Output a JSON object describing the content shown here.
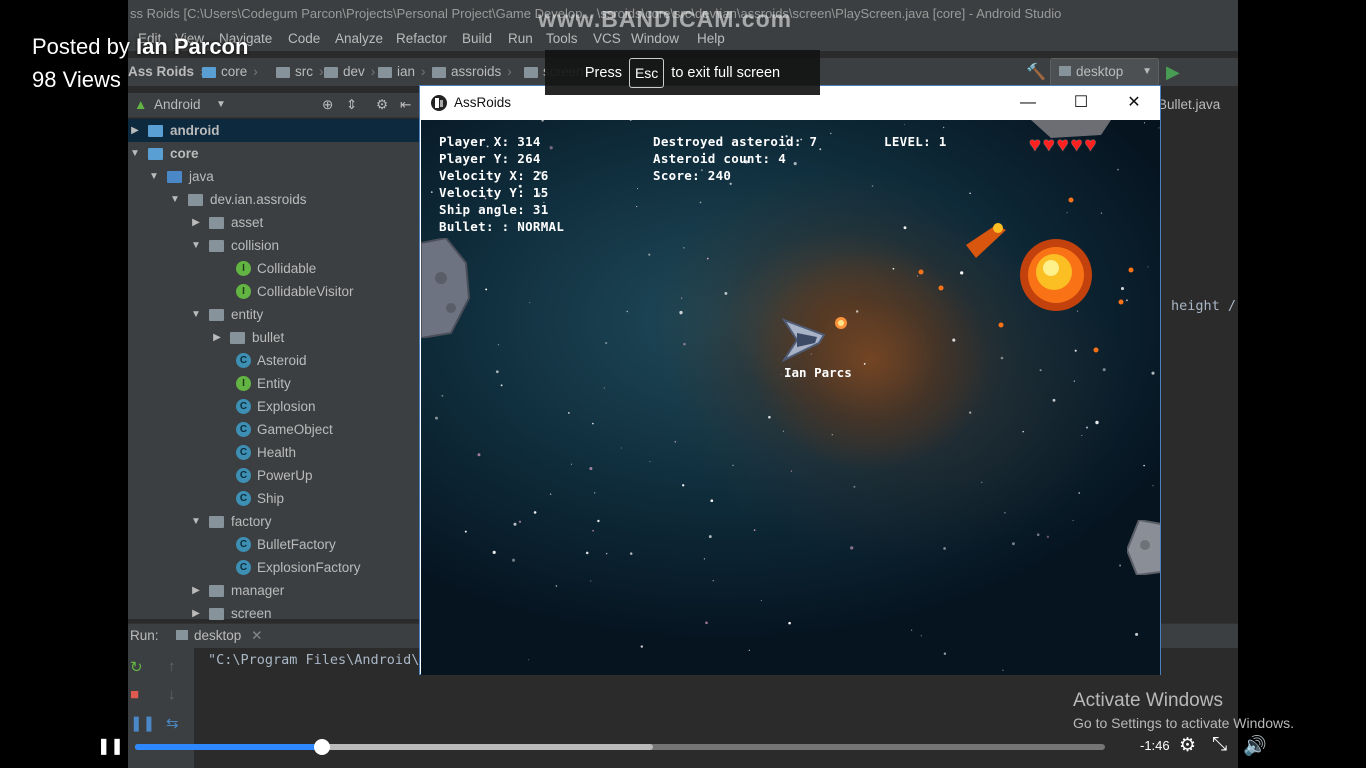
{
  "video": {
    "posted_by_prefix": "Posted by ",
    "author": "Ian Parcon",
    "views": "98 Views",
    "fullscreen_tip_press": "Press",
    "fullscreen_tip_key": "Esc",
    "fullscreen_tip_rest": "to exit full screen",
    "watermark": "www.BANDICAM.com",
    "time_remaining": "-1:46",
    "progress_fraction": 0.193,
    "buffered_fraction": 0.534,
    "accent_color": "#2d88ff"
  },
  "ide": {
    "title": "ss Roids [C:\\Users\\Codegum Parcon\\Projects\\Personal Project\\Game Develop... \\ssroids\\core\\src\\dev\\ian\\assroids\\screen\\PlayScreen.java [core] - Android Studio",
    "menu": [
      "Edit",
      "View",
      "Navigate",
      "Code",
      "Analyze",
      "Refactor",
      "Build",
      "Run",
      "Tools",
      "VCS",
      "Window",
      "Help"
    ],
    "breadcrumbs": [
      "Ass Roids",
      "core",
      "src",
      "dev",
      "ian",
      "assroids",
      "screen"
    ],
    "run_config": "desktop",
    "project_view": "Android",
    "editor_tab": "Bullet.java",
    "code_fragment": "height /",
    "tree": [
      {
        "label": "android",
        "depth": 0,
        "kind": "module",
        "expanded": false
      },
      {
        "label": "core",
        "depth": 0,
        "kind": "module",
        "expanded": true
      },
      {
        "label": "java",
        "depth": 1,
        "kind": "source",
        "expanded": true
      },
      {
        "label": "dev.ian.assroids",
        "depth": 2,
        "kind": "package",
        "expanded": true
      },
      {
        "label": "asset",
        "depth": 3,
        "kind": "package",
        "expanded": false
      },
      {
        "label": "collision",
        "depth": 3,
        "kind": "package",
        "expanded": true
      },
      {
        "label": "Collidable",
        "depth": 4,
        "kind": "interface"
      },
      {
        "label": "CollidableVisitor",
        "depth": 4,
        "kind": "interface"
      },
      {
        "label": "entity",
        "depth": 3,
        "kind": "package",
        "expanded": true
      },
      {
        "label": "bullet",
        "depth": 4,
        "kind": "package",
        "expanded": false
      },
      {
        "label": "Asteroid",
        "depth": 4,
        "kind": "class"
      },
      {
        "label": "Entity",
        "depth": 4,
        "kind": "interface"
      },
      {
        "label": "Explosion",
        "depth": 4,
        "kind": "class"
      },
      {
        "label": "GameObject",
        "depth": 4,
        "kind": "class"
      },
      {
        "label": "Health",
        "depth": 4,
        "kind": "class"
      },
      {
        "label": "PowerUp",
        "depth": 4,
        "kind": "class"
      },
      {
        "label": "Ship",
        "depth": 4,
        "kind": "class"
      },
      {
        "label": "factory",
        "depth": 3,
        "kind": "package",
        "expanded": true
      },
      {
        "label": "BulletFactory",
        "depth": 4,
        "kind": "class"
      },
      {
        "label": "ExplosionFactory",
        "depth": 4,
        "kind": "class"
      },
      {
        "label": "manager",
        "depth": 3,
        "kind": "package",
        "expanded": false
      },
      {
        "label": "screen",
        "depth": 3,
        "kind": "package",
        "expanded": false
      }
    ],
    "run_label": "Run:",
    "run_tab": "desktop",
    "run_output": "\"C:\\Program Files\\Android\\"
  },
  "game": {
    "window_title": "AssRoids",
    "hud_left": [
      "Player X: 314",
      "Player Y: 264",
      "Velocity X: 26",
      "Velocity Y: 15",
      "Ship angle: 31",
      "Bullet: : NORMAL"
    ],
    "hud_mid": [
      "Destroyed asteroid: 7",
      "Asteroid count: 4",
      "Score: 240"
    ],
    "hud_level": "LEVEL: 1",
    "lives": 5,
    "player_name": "Ian Parcs"
  },
  "windows_notice": {
    "title": "Activate Windows",
    "subtitle": "Go to Settings to activate Windows."
  }
}
